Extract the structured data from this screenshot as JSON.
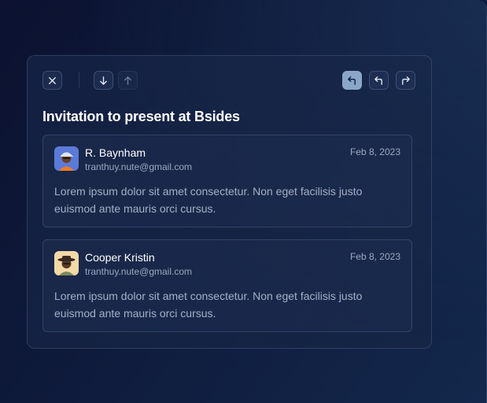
{
  "email": {
    "subject": "Invitation to present at Bsides"
  },
  "toolbar": {
    "close_icon": "close-icon",
    "next_icon": "arrow-down-icon",
    "prev_icon": "arrow-up-icon",
    "reply_icon": "reply-icon",
    "reply_all_icon": "reply-all-icon",
    "forward_icon": "forward-icon",
    "active_color": "#8aa6c9"
  },
  "messages": [
    {
      "sender": "R. Baynham",
      "email": "tranthuy.nute@gmail.com",
      "date": "Feb 8, 2023",
      "body": "Lorem ipsum dolor sit amet consectetur. Non eget facilisis justo euismod ante mauris orci cursus.",
      "avatar_bg": "#5a7bd8"
    },
    {
      "sender": "Cooper Kristin",
      "email": "tranthuy.nute@gmail.com",
      "date": "Feb 8, 2023",
      "body": "Lorem ipsum dolor sit amet consectetur. Non eget facilisis justo euismod ante mauris orci cursus.",
      "avatar_bg": "#f3d9a8"
    }
  ]
}
